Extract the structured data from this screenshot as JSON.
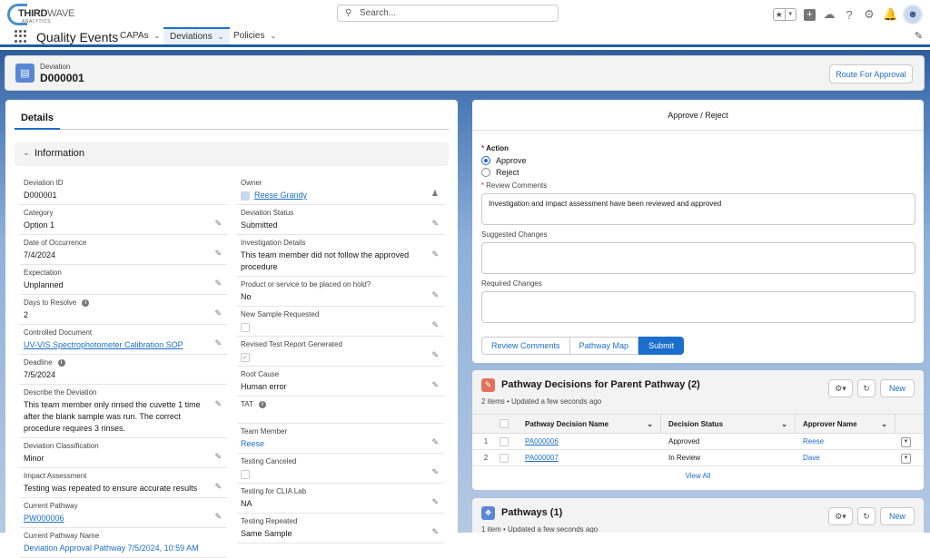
{
  "topbar": {
    "logo_main_bold": "THIRD",
    "logo_main_light": "WAVE",
    "logo_sub": "ANALYTICS",
    "search_placeholder": "Search...",
    "icons": [
      "favorites-star-icon",
      "add-icon",
      "trailhead-icon",
      "help-icon",
      "setup-gear-icon",
      "notifications-bell-icon",
      "user-avatar"
    ]
  },
  "nav": {
    "app_name": "Quality Events",
    "tabs": [
      {
        "label": "CAPAs",
        "active": false
      },
      {
        "label": "Deviations",
        "active": true
      },
      {
        "label": "Policies",
        "active": false
      }
    ]
  },
  "record": {
    "object_label": "Deviation",
    "name": "D000001",
    "route_button": "Route For Approval"
  },
  "details": {
    "tab": "Details",
    "section": "Information",
    "left_fields": [
      {
        "label": "Deviation ID",
        "value": "D000001"
      },
      {
        "label": "Category",
        "value": "Option 1"
      },
      {
        "label": "Date of Occurrence",
        "value": "7/4/2024"
      },
      {
        "label": "Expectation",
        "value": "Unplanned"
      },
      {
        "label": "Days to Resolve",
        "value": "2"
      },
      {
        "label": "Controlled Document",
        "value": "UV-VIS Spectrophotometer Calibration SOP"
      },
      {
        "label": "Deadline",
        "value": "7/5/2024"
      },
      {
        "label": "Describe the Deviation",
        "value": "This team member only rinsed the cuvette 1 time after the blank sample was run. The correct procedure requires 3 rinses."
      },
      {
        "label": "Deviation Classification",
        "value": "Minor"
      },
      {
        "label": "Impact Assessment",
        "value": "Testing was repeated to ensure accurate results"
      },
      {
        "label": "Current Pathway",
        "value": "PW000006"
      },
      {
        "label": "Current Pathway Name",
        "value": "Deviation Approval Pathway 7/5/2024, 10:59 AM"
      }
    ],
    "right_fields": [
      {
        "label": "Owner",
        "value": "Reese Grandy"
      },
      {
        "label": "Deviation Status",
        "value": "Submitted"
      },
      {
        "label": "Investigation Details",
        "value": "This team member did not follow the approved procedure"
      },
      {
        "label": "Product or service to be placed on hold?",
        "value": "No"
      },
      {
        "label": "New Sample Requested",
        "value": false
      },
      {
        "label": "Revised Test Report Generated",
        "value": true
      },
      {
        "label": "Root Cause",
        "value": "Human error"
      },
      {
        "label": "TAT",
        "value": ""
      },
      {
        "label": "Team Member",
        "value": "Reese"
      },
      {
        "label": "Testing Canceled",
        "value": false
      },
      {
        "label": "Testing for CLIA Lab",
        "value": "NA"
      },
      {
        "label": "Testing Repeated",
        "value": "Same Sample"
      }
    ]
  },
  "approve": {
    "title": "Approve / Reject",
    "action_label": "Action",
    "options": [
      {
        "label": "Approve",
        "selected": true
      },
      {
        "label": "Reject",
        "selected": false
      }
    ],
    "review_comments_label": "Review Comments",
    "review_comments_value": "Investigation and impact assessment have been reviewed and approved",
    "suggested_changes_label": "Suggested Changes",
    "suggested_changes_value": "",
    "required_changes_label": "Required Changes",
    "required_changes_value": "",
    "buttons": {
      "review": "Review Comments",
      "map": "Pathway Map",
      "submit": "Submit"
    }
  },
  "decisions": {
    "title": "Pathway Decisions for Parent Pathway (2)",
    "subtitle": "2 items • Updated a few seconds ago",
    "new_label": "New",
    "columns": [
      "Pathway Decision Name",
      "Decision Status",
      "Approver Name"
    ],
    "rows": [
      {
        "num": "1",
        "name": "PA000006",
        "status": "Approved",
        "approver": "Reese"
      },
      {
        "num": "2",
        "name": "PA000007",
        "status": "In Review",
        "approver": "Dave"
      }
    ],
    "view_all": "View All"
  },
  "pathways": {
    "title": "Pathways (1)",
    "subtitle": "1 item • Updated a few seconds ago",
    "new_label": "New"
  },
  "colors": {
    "brand": "#1b6ecb",
    "nav_border": "#1b5fa5",
    "required": "#c23934",
    "decision_icon": "#e2725b",
    "pathway_icon": "#5a86d6"
  }
}
